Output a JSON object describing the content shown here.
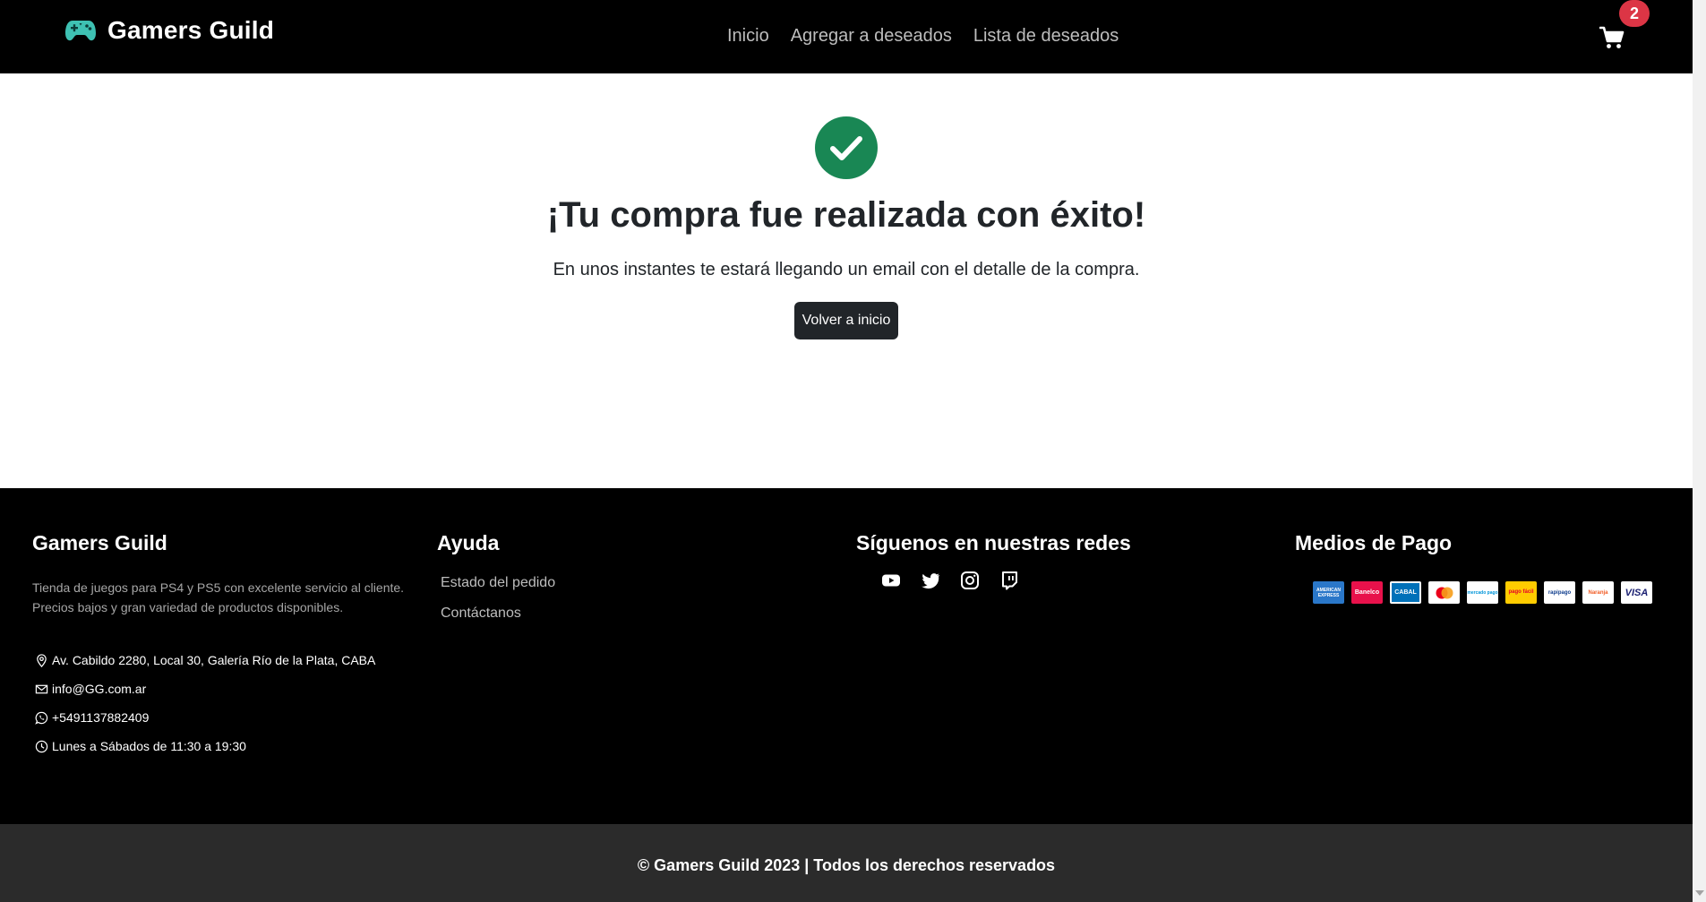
{
  "navbar": {
    "brand": "Gamers Guild",
    "links": [
      "Inicio",
      "Agregar a deseados",
      "Lista de deseados"
    ],
    "cart_count": "2"
  },
  "main": {
    "title": "¡Tu compra fue realizada con éxito!",
    "subtitle": "En unos instantes te estará llegando un email con el detalle de la compra.",
    "button": "Volver a inicio"
  },
  "footer": {
    "about_title": "Gamers Guild",
    "about_text": "Tienda de juegos para PS4 y PS5 con excelente servicio al cliente. Precios bajos y gran variedad de productos disponibles.",
    "contact": {
      "address": "Av. Cabildo 2280, Local 30, Galería Río de la Plata, CABA",
      "email": "info@GG.com.ar",
      "phone": "+5491137882409",
      "hours": "Lunes a Sábados de 11:30 a 19:30"
    },
    "help_title": "Ayuda",
    "help_links": [
      "Estado del pedido",
      "Contáctanos"
    ],
    "social_title": "Síguenos en nuestras redes",
    "payments_title": "Medios de Pago",
    "payment_logos": {
      "amex": "AMERICAN EXPRESS",
      "banelco": "Banelco",
      "cabal": "CABAL",
      "mercadopago": "mercado pago",
      "pagofacil": "pago fácil",
      "rapipago": "rapipago",
      "naranja": "Naranja",
      "visa": "VISA"
    },
    "copyright": "© Gamers Guild 2023 | Todos los derechos reservados"
  },
  "colors": {
    "accent_green": "#198754",
    "badge_red": "#dc3545",
    "brand_icon": "#3ec1b3"
  }
}
